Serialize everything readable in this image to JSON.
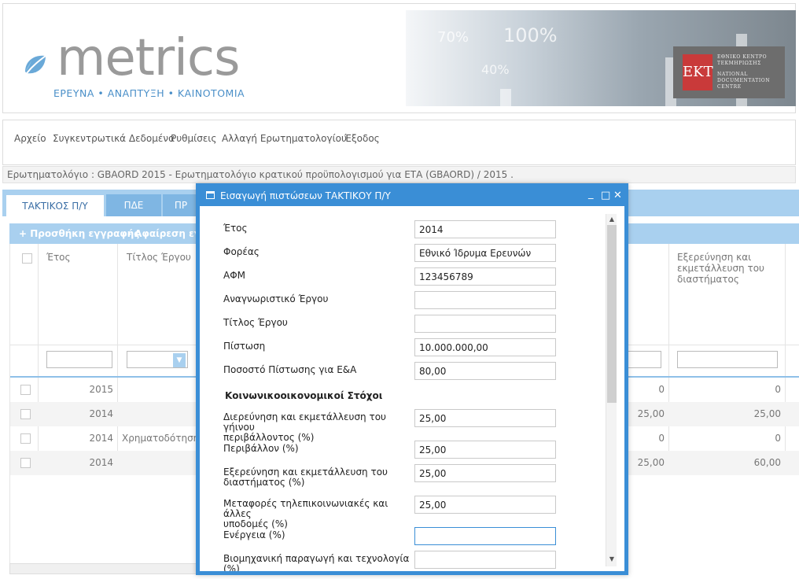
{
  "brand": {
    "logo_word": "metrics",
    "tagline": "ΕΡΕΥΝΑ • ΑΝΑΠΤΥΞΗ • ΚΑΙΝΟΤΟΜΙΑ",
    "banner_pct_1": "70%",
    "banner_pct_2": "100%",
    "banner_pct_3": "40%",
    "ekt_mark": "EKT",
    "ekt_line_1": "ΕΘΝΙΚΟ ΚΕΝΤΡΟ",
    "ekt_line_2": "ΤΕΚΜΗΡΙΩΣΗΣ",
    "ekt_line_3": "NATIONAL",
    "ekt_line_4": "DOCUMENTATION",
    "ekt_line_5": "CENTRE",
    "accent_color": "#3a8ed6"
  },
  "menu": {
    "file": "Αρχείο",
    "aggregates": "Συγκεντρωτικά Δεδομένα",
    "settings": "Ρυθμίσεις",
    "change_questionnaire": "Αλλαγή Ερωτηματολογίου",
    "exit": "Έξοδος"
  },
  "breadcrumb": "Ερωτηματολόγιο : GBAORD 2015 - Ερωτηματολόγιο κρατικού προϋπολογισμού για ΕΤΑ (GBAORD) / 2015 .",
  "tabs": [
    {
      "label": "ΤΑΚΤΙΚΟΣ Π/Υ"
    },
    {
      "label": "ΠΔΕ"
    },
    {
      "label": "ΠΡ"
    }
  ],
  "grid": {
    "add_record": "+ Προσθήκη εγγραφής",
    "remove_record": "- Αφαίρεση εγγρ",
    "col_year": "Έτος",
    "col_title": "Τίτλος Έργου",
    "col_space_1": "Εξερεύνηση και",
    "col_space_2": "εκμετάλλευση του",
    "col_space_3": "διαστήματος",
    "rows": [
      {
        "year": "2015",
        "title": "",
        "c1": "0",
        "c2": "0"
      },
      {
        "year": "2014",
        "title": "",
        "c1": "25,00",
        "c2": "25,00"
      },
      {
        "year": "2014",
        "title": "Χρηματοδότηση '",
        "c1": "0",
        "c2": "0"
      },
      {
        "year": "2014",
        "title": "",
        "c1": "25,00",
        "c2": "60,00"
      }
    ]
  },
  "dialog": {
    "title": "Εισαγωγή πιστώσεων ΤΑΚΤΙΚΟΥ Π/Υ",
    "minimize": "_",
    "maximize": "□",
    "close": "✕",
    "section_goals": "Κοινωνικοοικονομικοί Στόχοι",
    "fields": [
      {
        "label": "Έτος",
        "value": "2014"
      },
      {
        "label": "Φορέας",
        "value": "Εθνικό Ίδρυμα Ερευνών"
      },
      {
        "label": "ΑΦΜ",
        "value": "123456789"
      },
      {
        "label": "Αναγνωριστικό Έργου",
        "value": ""
      },
      {
        "label": "Τίτλος Έργου",
        "value": ""
      },
      {
        "label": "Πίστωση",
        "value": "10.000.000,00"
      },
      {
        "label": "Ποσοστό Πίστωσης για Ε&Α",
        "value": "80,00"
      },
      {
        "label_1": "Διερεύνηση και εκμετάλλευση του γήινου",
        "label_2": "περιβάλλοντος (%)",
        "value": "25,00"
      },
      {
        "label": "Περιβάλλον (%)",
        "value": "25,00"
      },
      {
        "label_1": "Εξερεύνηση και εκμετάλλευση του",
        "label_2": "διαστήματος (%)",
        "value": "25,00"
      },
      {
        "label_1": "Μεταφορές τηλεπικοινωνιακές και άλλες",
        "label_2": "υποδομές (%)",
        "value": "25,00"
      },
      {
        "label": "Ενέργεια (%)",
        "value": ""
      },
      {
        "label": "Βιομηχανική παραγωγή και τεχνολογία (%)",
        "value": ""
      }
    ]
  }
}
